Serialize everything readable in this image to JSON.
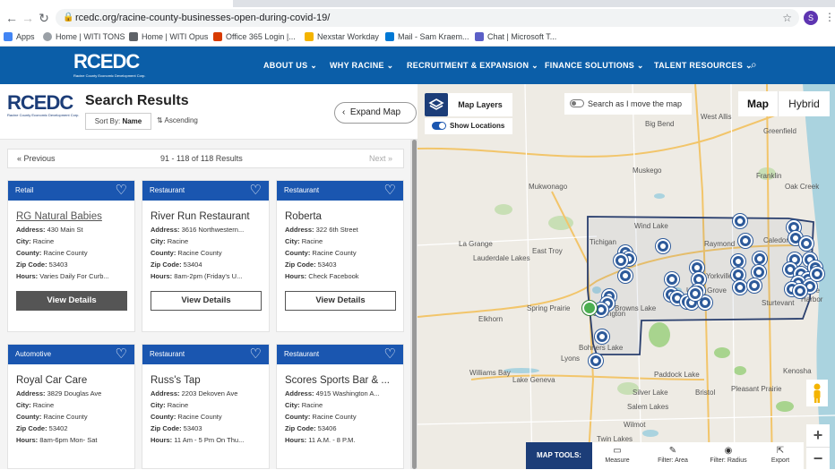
{
  "browser": {
    "url": "rcedc.org/racine-county-businesses-open-during-covid-19/",
    "profile_initial": "S",
    "bookmarks": [
      {
        "label": "Apps",
        "color": "#4285f4"
      },
      {
        "label": "Home | WITI TONS",
        "color": "#5f6368"
      },
      {
        "label": "Home | WITI Opus",
        "color": "#5f6368"
      },
      {
        "label": "Office 365 Login |...",
        "color": "#d83b01"
      },
      {
        "label": "Nexstar Workday",
        "color": "#f4b400"
      },
      {
        "label": "Mail - Sam Kraem...",
        "color": "#0078d4"
      },
      {
        "label": "Chat | Microsoft T...",
        "color": "#5b5fc7"
      }
    ]
  },
  "site": {
    "logo": "RCEDC",
    "logo_tagline": "Racine County Economic Development Corp.",
    "nav": [
      "ABOUT US",
      "WHY RACINE",
      "RECRUITMENT & EXPANSION",
      "FINANCE SOLUTIONS",
      "TALENT RESOURCES"
    ]
  },
  "panel": {
    "logo": "RCEDC",
    "logo_tagline": "Racine County Economic Development Corp.",
    "title": "Search Results",
    "sort_label": "Sort By:",
    "sort_value": "Name",
    "sort_order": "Ascending",
    "expand_map": "Expand Map",
    "prev": "Previous",
    "next": "Next",
    "result_count": "91 - 118 of 118 Results"
  },
  "cards": [
    {
      "category": "Retail",
      "name": "RG Natural Babies",
      "address": "430 Main St",
      "city": "Racine",
      "county": "Racine County",
      "zip": "53403",
      "hours": "Varies Daily For Curb...",
      "button": "View Details"
    },
    {
      "category": "Restaurant",
      "name": "River Run Restaurant",
      "address": "3616 Northwestern...",
      "city": "Racine",
      "county": "Racine County",
      "zip": "53404",
      "hours": "8am-2pm (Friday's U...",
      "button": "View Details"
    },
    {
      "category": "Restaurant",
      "name": "Roberta",
      "address": "322 6th Street",
      "city": "Racine",
      "county": "Racine County",
      "zip": "53403",
      "hours": "Check Facebook",
      "button": "View Details"
    },
    {
      "category": "Automotive",
      "name": "Royal Car Care",
      "address": "3829 Douglas Ave",
      "city": "Racine",
      "county": "Racine County",
      "zip": "53402",
      "hours": "8am-6pm Mon- Sat"
    },
    {
      "category": "Restaurant",
      "name": "Russ's Tap",
      "address": "2203 Dekoven Ave",
      "city": "Racine",
      "county": "Racine County",
      "zip": "53403",
      "hours": "11 Am - 5 Pm On Thu..."
    },
    {
      "category": "Restaurant",
      "name": "Scores Sports Bar & ...",
      "address": "4915 Washington A...",
      "city": "Racine",
      "county": "Racine County",
      "zip": "53406",
      "hours": "11 A.M. - 8 P.M."
    }
  ],
  "field_labels": {
    "address": "Address:",
    "city": "City:",
    "county": "County:",
    "zip": "Zip Code:",
    "hours": "Hours:"
  },
  "map": {
    "layers": "Map Layers",
    "show_locations": "Show Locations",
    "search_as_move": "Search as I move the map",
    "map_tab": "Map",
    "hybrid_tab": "Hybrid",
    "tools_label": "MAP TOOLS:",
    "tools": [
      {
        "label": "Measure",
        "icon": "ruler-icon",
        "glyph": "▭"
      },
      {
        "label": "Filter: Area",
        "icon": "area-icon",
        "glyph": "✎"
      },
      {
        "label": "Filter: Radius",
        "icon": "radius-icon",
        "glyph": "◉"
      },
      {
        "label": "Export",
        "icon": "export-icon",
        "glyph": "⇱"
      }
    ],
    "place_labels": [
      "West Allis",
      "Greenfield",
      "Franklin",
      "Oak Creek",
      "Muskego",
      "Big Bend",
      "Mukwonago",
      "La Grange",
      "Lauderdale Lakes",
      "East Troy",
      "Wind Lake",
      "Tichigan",
      "Raymond",
      "Yorkville",
      "Union Grove",
      "Sturtevant",
      "Spring Prairie",
      "Elkhorn",
      "Burlington",
      "Browns Lake",
      "Bohners Lake",
      "Lyons",
      "Williams Bay",
      "Lake Geneva",
      "Paddock Lake",
      "Bristol",
      "Pleasant Prairie",
      "Kenosha",
      "Salem Lakes",
      "Silver Lake",
      "Wilmot",
      "Twin Lakes",
      "Caledonia",
      "Racine",
      "Harbor"
    ]
  }
}
